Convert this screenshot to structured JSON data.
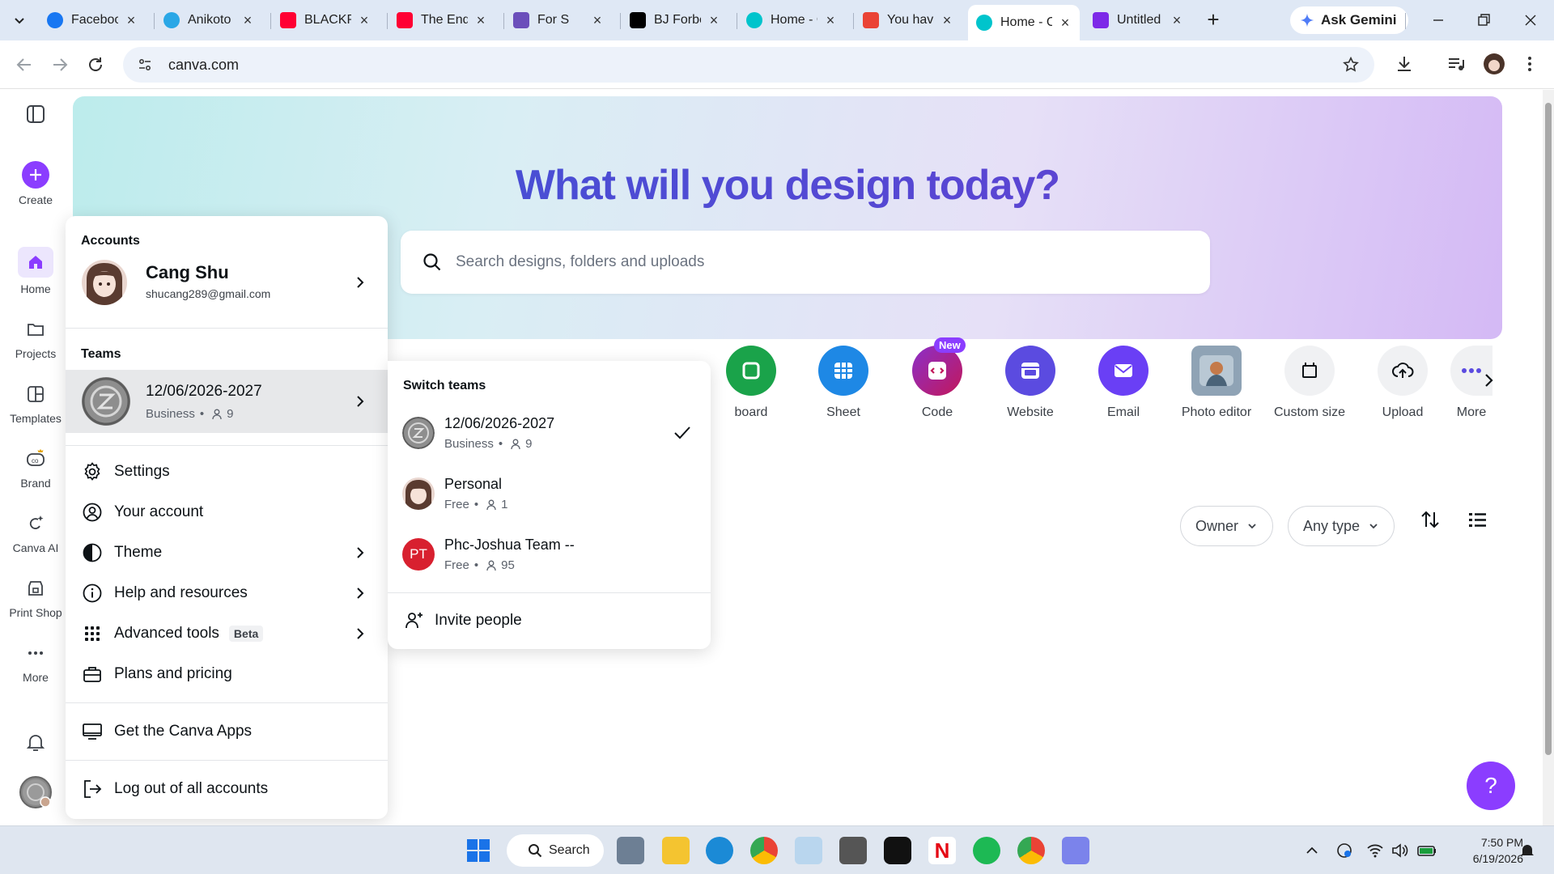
{
  "browser": {
    "tabs": [
      {
        "label": "Facebook",
        "favicon_color": "#1877f2"
      },
      {
        "label": "Anikoto",
        "favicon_color": "#2aa7e6"
      },
      {
        "label": "BLACKPINK",
        "favicon_color": "#ff0033"
      },
      {
        "label": "The End",
        "favicon_color": "#ff0033"
      },
      {
        "label": "For S",
        "favicon_color": "#6b4fbb"
      },
      {
        "label": "BJ Forbes",
        "favicon_color": "#000000"
      },
      {
        "label": "Home - Canva",
        "favicon_color": "#00c4cc"
      },
      {
        "label": "You have",
        "favicon_color": "#ea4335"
      },
      {
        "label": "Home - Canva",
        "favicon_color": "#00c4cc",
        "active": true
      },
      {
        "label": "Untitled",
        "favicon_color": "#7d2ae8"
      }
    ],
    "ask_gemini": "Ask Gemini",
    "url": "canva.com"
  },
  "sidebar": {
    "create": "Create",
    "items": [
      {
        "label": "Home",
        "icon": "home-icon",
        "active": true
      },
      {
        "label": "Projects",
        "icon": "folder-icon"
      },
      {
        "label": "Templates",
        "icon": "templates-icon"
      },
      {
        "label": "Brand",
        "icon": "brand-icon"
      },
      {
        "label": "Canva AI",
        "icon": "canva-ai-icon"
      },
      {
        "label": "Print Shop",
        "icon": "print-shop-icon"
      },
      {
        "label": "More",
        "icon": "more-dots-icon"
      }
    ]
  },
  "hero": {
    "title": "What will you design today?",
    "search_placeholder": "Search designs, folders and uploads"
  },
  "design_types": [
    {
      "label": "board",
      "color": "#1aa34a"
    },
    {
      "label": "Sheet",
      "color": "#1e88e5"
    },
    {
      "label": "Code",
      "color": "#c2185b",
      "badge": "New"
    },
    {
      "label": "Website",
      "color": "#5b4be0"
    },
    {
      "label": "Email",
      "color": "#6a3ff5"
    },
    {
      "label": "Photo editor",
      "color": "#8fa3b5"
    },
    {
      "label": "Custom size",
      "color": "#f0f1f3"
    },
    {
      "label": "Upload",
      "color": "#f0f1f3"
    },
    {
      "label": "More",
      "color": "#f0f1f3"
    }
  ],
  "filters": {
    "owner": "Owner",
    "type": "Any type"
  },
  "account_menu": {
    "accounts_heading": "Accounts",
    "user_name": "Cang Shu",
    "user_email": "shucang289@gmail.com",
    "teams_heading": "Teams",
    "current_team": {
      "name": "12/06/2026-2027",
      "plan": "Business",
      "members": "9"
    },
    "items": {
      "settings": "Settings",
      "your_account": "Your account",
      "theme": "Theme",
      "help": "Help and resources",
      "advanced": "Advanced tools",
      "advanced_badge": "Beta",
      "plans": "Plans and pricing",
      "apps": "Get the Canva Apps",
      "logout": "Log out of all accounts"
    }
  },
  "switch_teams": {
    "heading": "Switch teams",
    "teams": [
      {
        "name": "12/06/2026-2027",
        "plan": "Business",
        "members": "9",
        "selected": true
      },
      {
        "name": "Personal",
        "plan": "Free",
        "members": "1"
      },
      {
        "name": "Phc-Joshua Team --",
        "plan": "Free",
        "members": "95",
        "initials": "PT"
      }
    ],
    "invite": "Invite people"
  },
  "taskbar": {
    "search": "Search",
    "time": "7:50 PM",
    "date": "6/19/2026"
  },
  "colors": {
    "accent": "#8b3dff",
    "hero_title": "#4f3ccf"
  }
}
